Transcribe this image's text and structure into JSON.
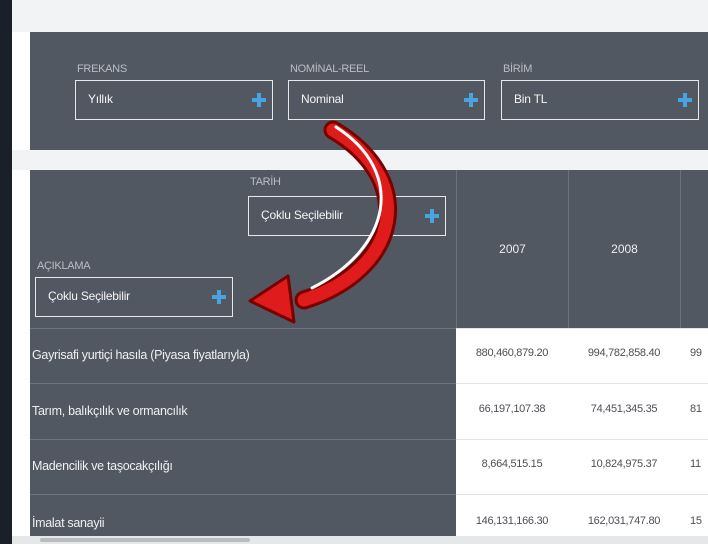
{
  "filters": {
    "frekans": {
      "label": "FREKANS",
      "value": "Yıllık"
    },
    "nominal_reel": {
      "label": "NOMİNAL-REEL",
      "value": "Nominal"
    },
    "birim": {
      "label": "BİRİM",
      "value": "Bin TL"
    }
  },
  "table": {
    "tarih": {
      "label": "TARİH",
      "value": "Çoklu Seçilebilir"
    },
    "aciklama": {
      "label": "AÇIKLAMA",
      "value": "Çoklu Seçilebilir"
    },
    "columns": [
      "2007",
      "2008",
      ""
    ],
    "rows": [
      {
        "label": "Gayrisafi yurtiçi hasıla (Piyasa fiyatlarıyla)",
        "values": [
          "880,460,879.20",
          "994,782,858.40",
          "99"
        ]
      },
      {
        "label": "Tarım, balıkçılık ve ormancılık",
        "values": [
          "66,197,107.38",
          "74,451,345.35",
          "81"
        ]
      },
      {
        "label": "Madencilik ve taşocakçılığı",
        "values": [
          "8,664,515.15",
          "10,824,975.37",
          "11"
        ]
      },
      {
        "label": "İmalat sanayii",
        "values": [
          "146,131,166.30",
          "162,031,747.80",
          "15"
        ]
      }
    ]
  },
  "colors": {
    "panel": "#525861",
    "accent_plus": "#4aa3df",
    "annotation_arrow": "#e01b1b"
  },
  "icons": [
    "plus-icon",
    "curved-arrow-annotation"
  ]
}
